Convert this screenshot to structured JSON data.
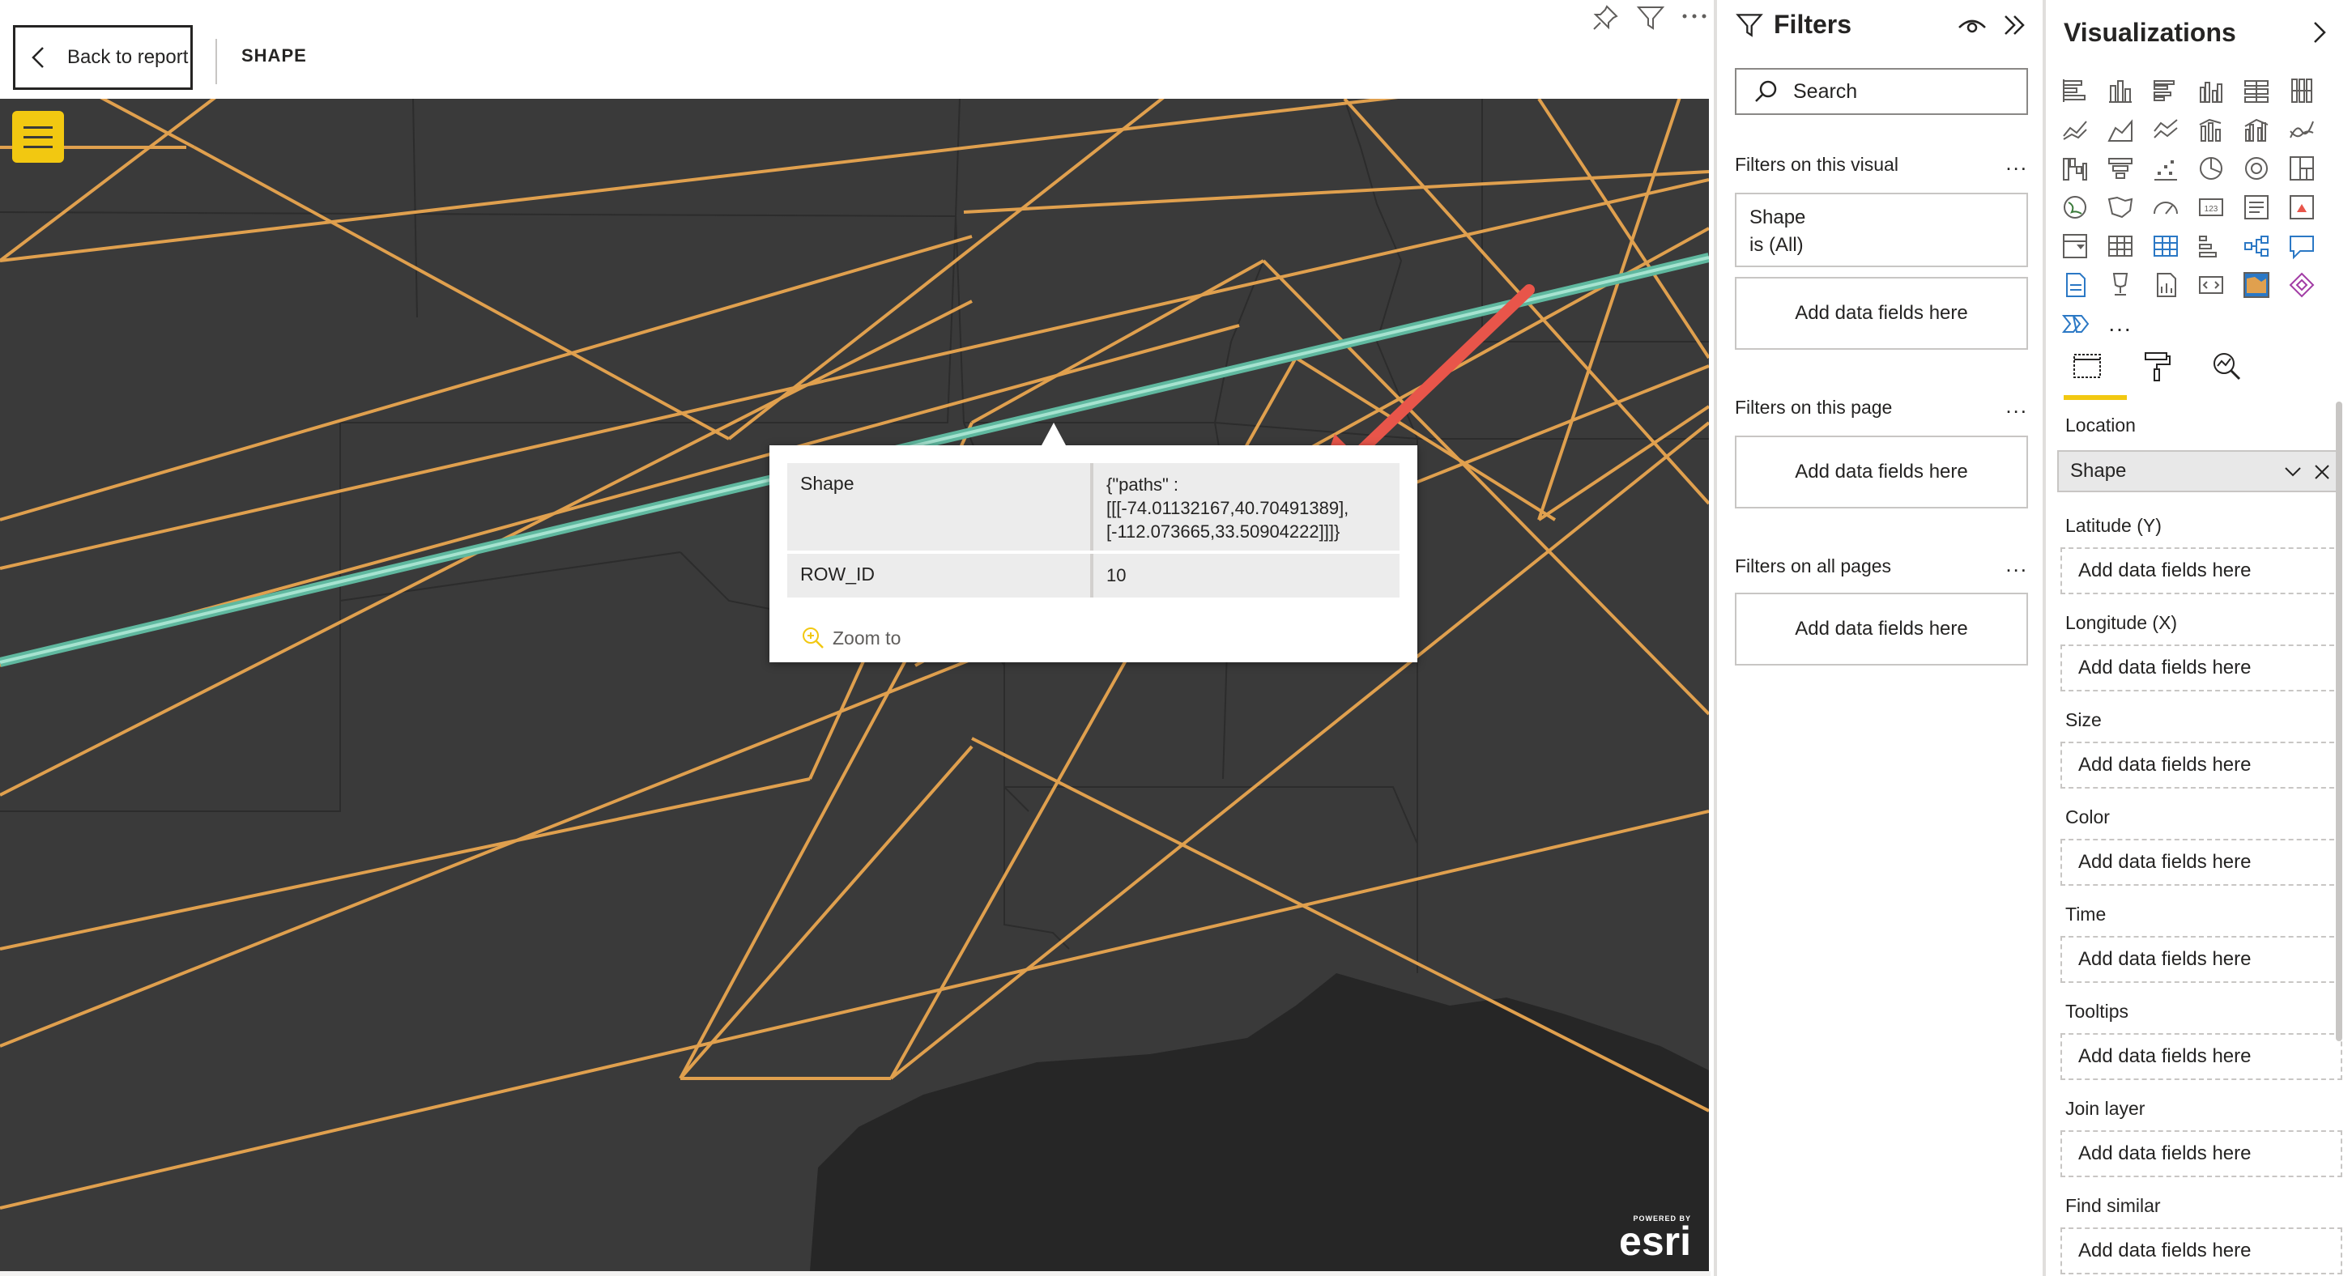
{
  "header": {
    "back_label": "Back to report",
    "page_title": "SHAPE"
  },
  "map": {
    "attribution_powered": "POWERED BY",
    "attribution_brand": "esri",
    "background_color": "#3a3a3a",
    "line_color": "#e0a04e",
    "selected_line_color": "#7fd1b9",
    "annotation_arrow_color": "#e8554a"
  },
  "tooltip": {
    "rows": [
      {
        "key": "Shape",
        "value_line1": "{\"paths\" :",
        "value_line2": "[[[-74.01132167,40.70491389],",
        "value_line3": "[-112.073665,33.50904222]]]}"
      },
      {
        "key": "ROW_ID",
        "value": "10"
      }
    ],
    "zoom_label": "Zoom to"
  },
  "filters": {
    "title": "Filters",
    "search_placeholder": "Search",
    "on_visual_label": "Filters on this visual",
    "on_page_label": "Filters on this page",
    "all_pages_label": "Filters on all pages",
    "more_label": "...",
    "shape_filter_name": "Shape",
    "shape_filter_value": "is (All)",
    "add_fields": "Add data fields here"
  },
  "visualizations": {
    "title": "Visualizations",
    "more_label": "...",
    "wells": {
      "location": "Location",
      "location_value": "Shape",
      "latitude": "Latitude (Y)",
      "longitude": "Longitude (X)",
      "size": "Size",
      "color": "Color",
      "time": "Time",
      "tooltips": "Tooltips",
      "join_layer": "Join layer",
      "find_similar": "Find similar"
    },
    "add_fields": "Add data fields here"
  },
  "colors": {
    "accent": "#f2c811",
    "text": "#252423"
  }
}
